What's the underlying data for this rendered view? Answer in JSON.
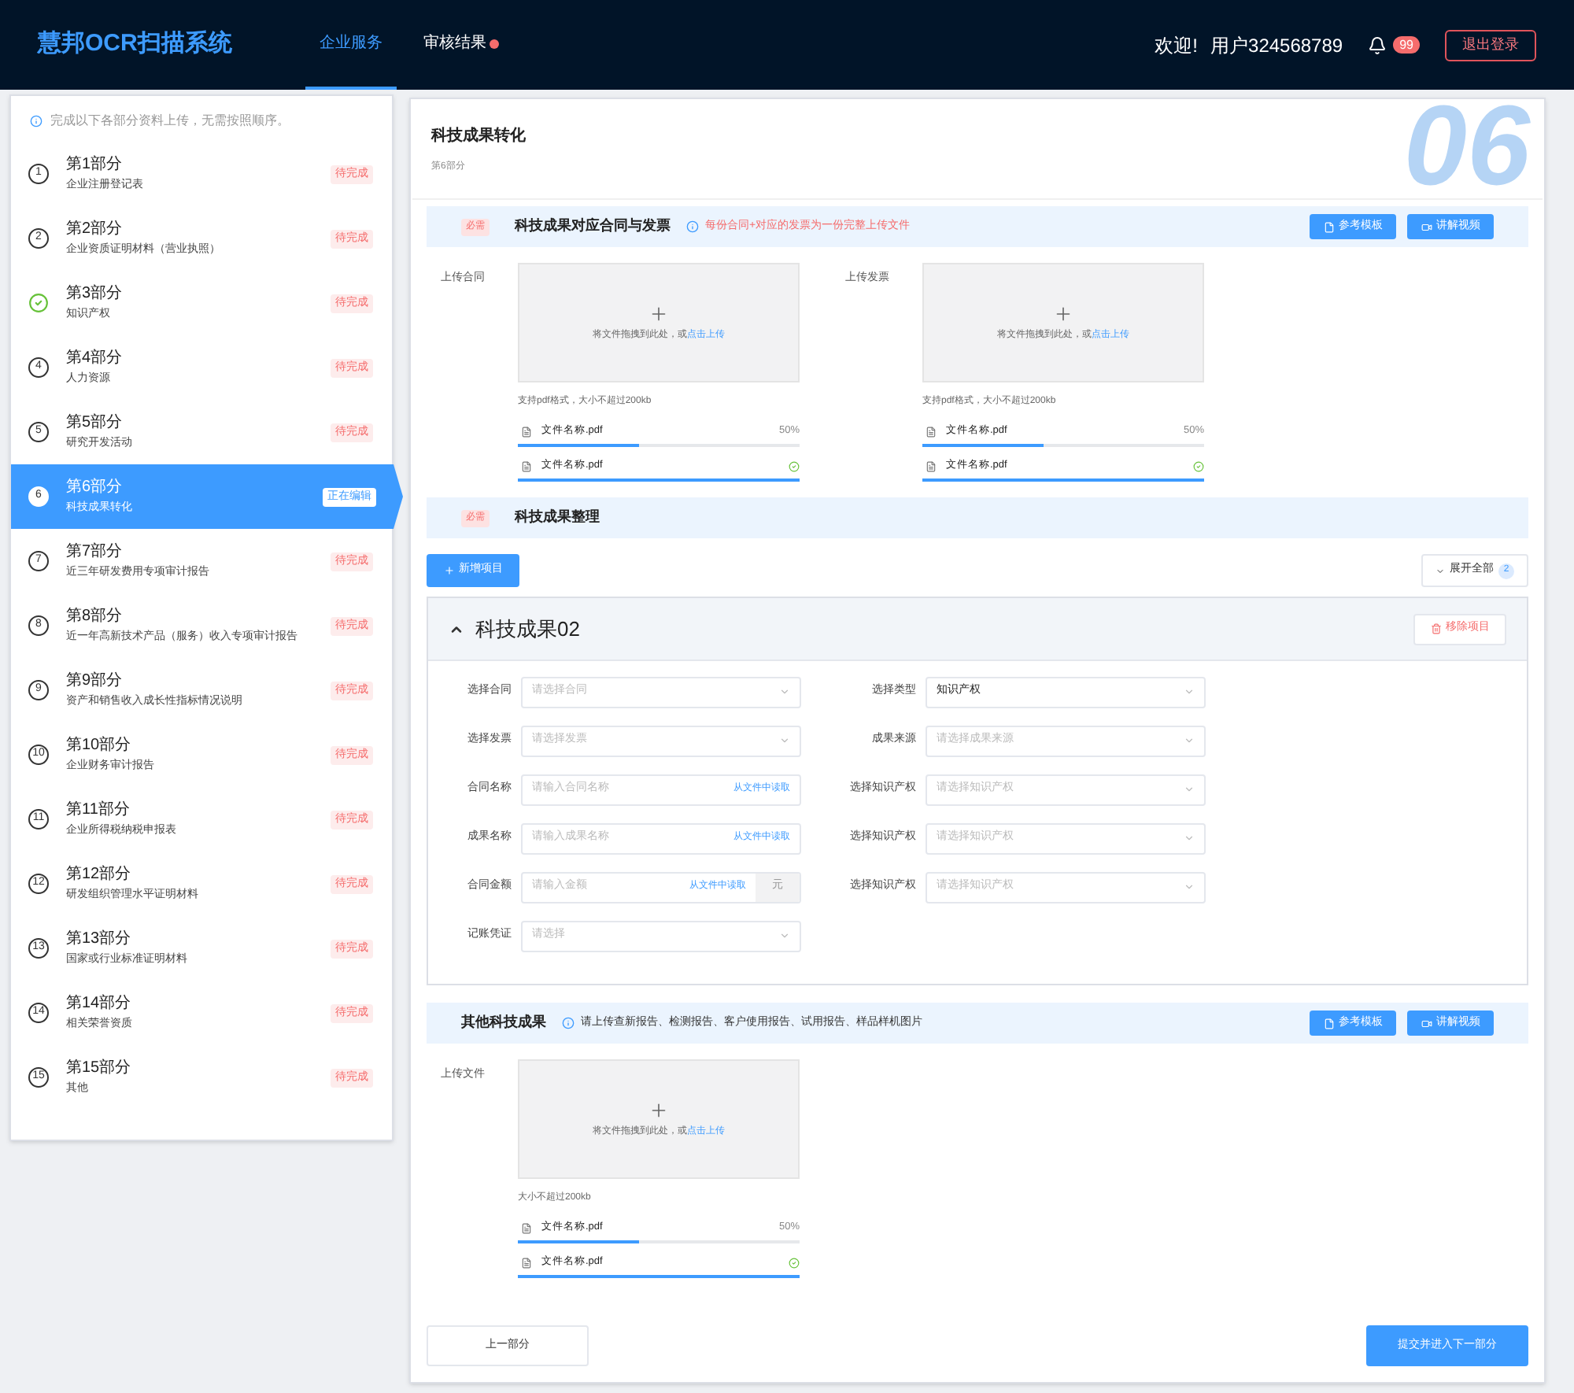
{
  "header": {
    "logo": "慧邦OCR扫描系统",
    "nav": [
      {
        "label": "企业服务",
        "selected": true,
        "dot": false
      },
      {
        "label": "审核结果",
        "selected": false,
        "dot": true
      }
    ],
    "welcome": "欢迎!",
    "user": "用户324568789",
    "notification_count": "99",
    "logout": "退出登录"
  },
  "sidebar": {
    "hint": "完成以下各部分资料上传，无需按照顺序。",
    "items": [
      {
        "number": "1",
        "title": "第1部分",
        "subtitle": "企业注册登记表",
        "status": "待完成",
        "selected": false,
        "done": false
      },
      {
        "number": "2",
        "title": "第2部分",
        "subtitle": "企业资质证明材料（营业执照）",
        "status": "待完成",
        "selected": false,
        "done": false
      },
      {
        "title": "第3部分",
        "subtitle": "知识产权",
        "status": "待完成",
        "selected": false,
        "done": true
      },
      {
        "number": "4",
        "title": "第4部分",
        "subtitle": "人力资源",
        "status": "待完成",
        "selected": false,
        "done": false
      },
      {
        "number": "5",
        "title": "第5部分",
        "subtitle": "研究开发活动",
        "status": "待完成",
        "selected": false,
        "done": false
      },
      {
        "number": "6",
        "title": "第6部分",
        "subtitle": "科技成果转化",
        "status": "正在编辑",
        "selected": true,
        "done": false
      },
      {
        "number": "7",
        "title": "第7部分",
        "subtitle": "近三年研发费用专项审计报告",
        "status": "待完成",
        "selected": false,
        "done": false
      },
      {
        "number": "8",
        "title": "第8部分",
        "subtitle": "近一年高新技术产品（服务）收入专项审计报告",
        "status": "待完成",
        "selected": false,
        "done": false
      },
      {
        "number": "9",
        "title": "第9部分",
        "subtitle": "资产和销售收入成长性指标情况说明",
        "status": "待完成",
        "selected": false,
        "done": false
      },
      {
        "number": "10",
        "title": "第10部分",
        "subtitle": "企业财务审计报告",
        "status": "待完成",
        "selected": false,
        "done": false
      },
      {
        "number": "11",
        "title": "第11部分",
        "subtitle": "企业所得税纳税申报表",
        "status": "待完成",
        "selected": false,
        "done": false
      },
      {
        "number": "12",
        "title": "第12部分",
        "subtitle": "研发组织管理水平证明材料",
        "status": "待完成",
        "selected": false,
        "done": false
      },
      {
        "number": "13",
        "title": "第13部分",
        "subtitle": "国家或行业标准证明材料",
        "status": "待完成",
        "selected": false,
        "done": false
      },
      {
        "number": "14",
        "title": "第14部分",
        "subtitle": "相关荣誉资质",
        "status": "待完成",
        "selected": false,
        "done": false
      },
      {
        "number": "15",
        "title": "第15部分",
        "subtitle": "其他",
        "status": "待完成",
        "selected": false,
        "done": false
      }
    ]
  },
  "main": {
    "title": "科技成果转化",
    "subtitle": "第6部分",
    "bg_number": "06",
    "sections": [
      {
        "kind": "upload",
        "tag": "必需",
        "title": "科技成果对应合同与发票",
        "note": "每份合同+对应的发票为一份完整上传文件",
        "note_warning": true,
        "buttons": [
          "参考模板",
          "讲解视频"
        ],
        "uploads": [
          {
            "label": "上传合同",
            "drop_text": "将文件拖拽到此处，或",
            "drop_link": "点击上传",
            "help": "支持pdf格式，大小不超过200kb",
            "files": [
              {
                "name": "文件名称.pdf",
                "percent": "50%",
                "level": 0.43,
                "done": false
              },
              {
                "name": "文件名称.pdf",
                "level": 1,
                "done": true
              }
            ]
          },
          {
            "label": "上传发票",
            "drop_text": "将文件拖拽到此处，或",
            "drop_link": "点击上传",
            "help": "支持pdf格式，大小不超过200kb",
            "files": [
              {
                "name": "文件名称.pdf",
                "percent": "50%",
                "level": 0.43,
                "done": false
              },
              {
                "name": "文件名称.pdf",
                "level": 1,
                "done": true
              }
            ]
          }
        ]
      },
      {
        "kind": "projects",
        "tag": "必需",
        "title": "科技成果整理",
        "add_button": "新增项目",
        "expand_button": "展开全部",
        "expand_count": "2",
        "project": {
          "title": "科技成果02",
          "expanded": true,
          "remove_button": "移除项目",
          "left_fields": [
            {
              "kind": "select",
              "label": "选择合同",
              "placeholder": "请选择合同"
            },
            {
              "kind": "select",
              "label": "选择发票",
              "placeholder": "请选择发票"
            },
            {
              "kind": "input",
              "label": "合同名称",
              "placeholder": "请输入合同名称",
              "action": "从文件中读取"
            },
            {
              "kind": "input",
              "label": "成果名称",
              "placeholder": "请输入成果名称",
              "action": "从文件中读取"
            },
            {
              "kind": "amount",
              "label": "合同金额",
              "placeholder": "请输入金额",
              "action": "从文件中读取",
              "unit": "元"
            },
            {
              "kind": "select",
              "label": "记账凭证",
              "placeholder": "请选择"
            }
          ],
          "right_fields": [
            {
              "kind": "select",
              "label": "选择类型",
              "value": "知识产权"
            },
            {
              "kind": "select",
              "label": "成果来源",
              "placeholder": "请选择成果来源"
            },
            {
              "kind": "select",
              "label": "选择知识产权",
              "placeholder": "请选择知识产权"
            },
            {
              "kind": "select",
              "label": "选择知识产权",
              "placeholder": "请选择知识产权"
            },
            {
              "kind": "select",
              "label": "选择知识产权",
              "placeholder": "请选择知识产权"
            }
          ]
        }
      },
      {
        "kind": "upload",
        "title": "其他科技成果",
        "note": "请上传查新报告、检测报告、客户使用报告、试用报告、样品样机图片",
        "note_warning": false,
        "buttons": [
          "参考模板",
          "讲解视频"
        ],
        "uploads": [
          {
            "label": "上传文件",
            "drop_text": "将文件拖拽到此处，或",
            "drop_link": "点击上传",
            "help": "大小不超过200kb",
            "files": [
              {
                "name": "文件名称.pdf",
                "percent": "50%",
                "level": 0.43,
                "done": false
              },
              {
                "name": "文件名称.pdf",
                "level": 1,
                "done": true
              }
            ]
          }
        ]
      }
    ],
    "prev_button": "上一部分",
    "next_button": "提交并进入下一部分"
  }
}
